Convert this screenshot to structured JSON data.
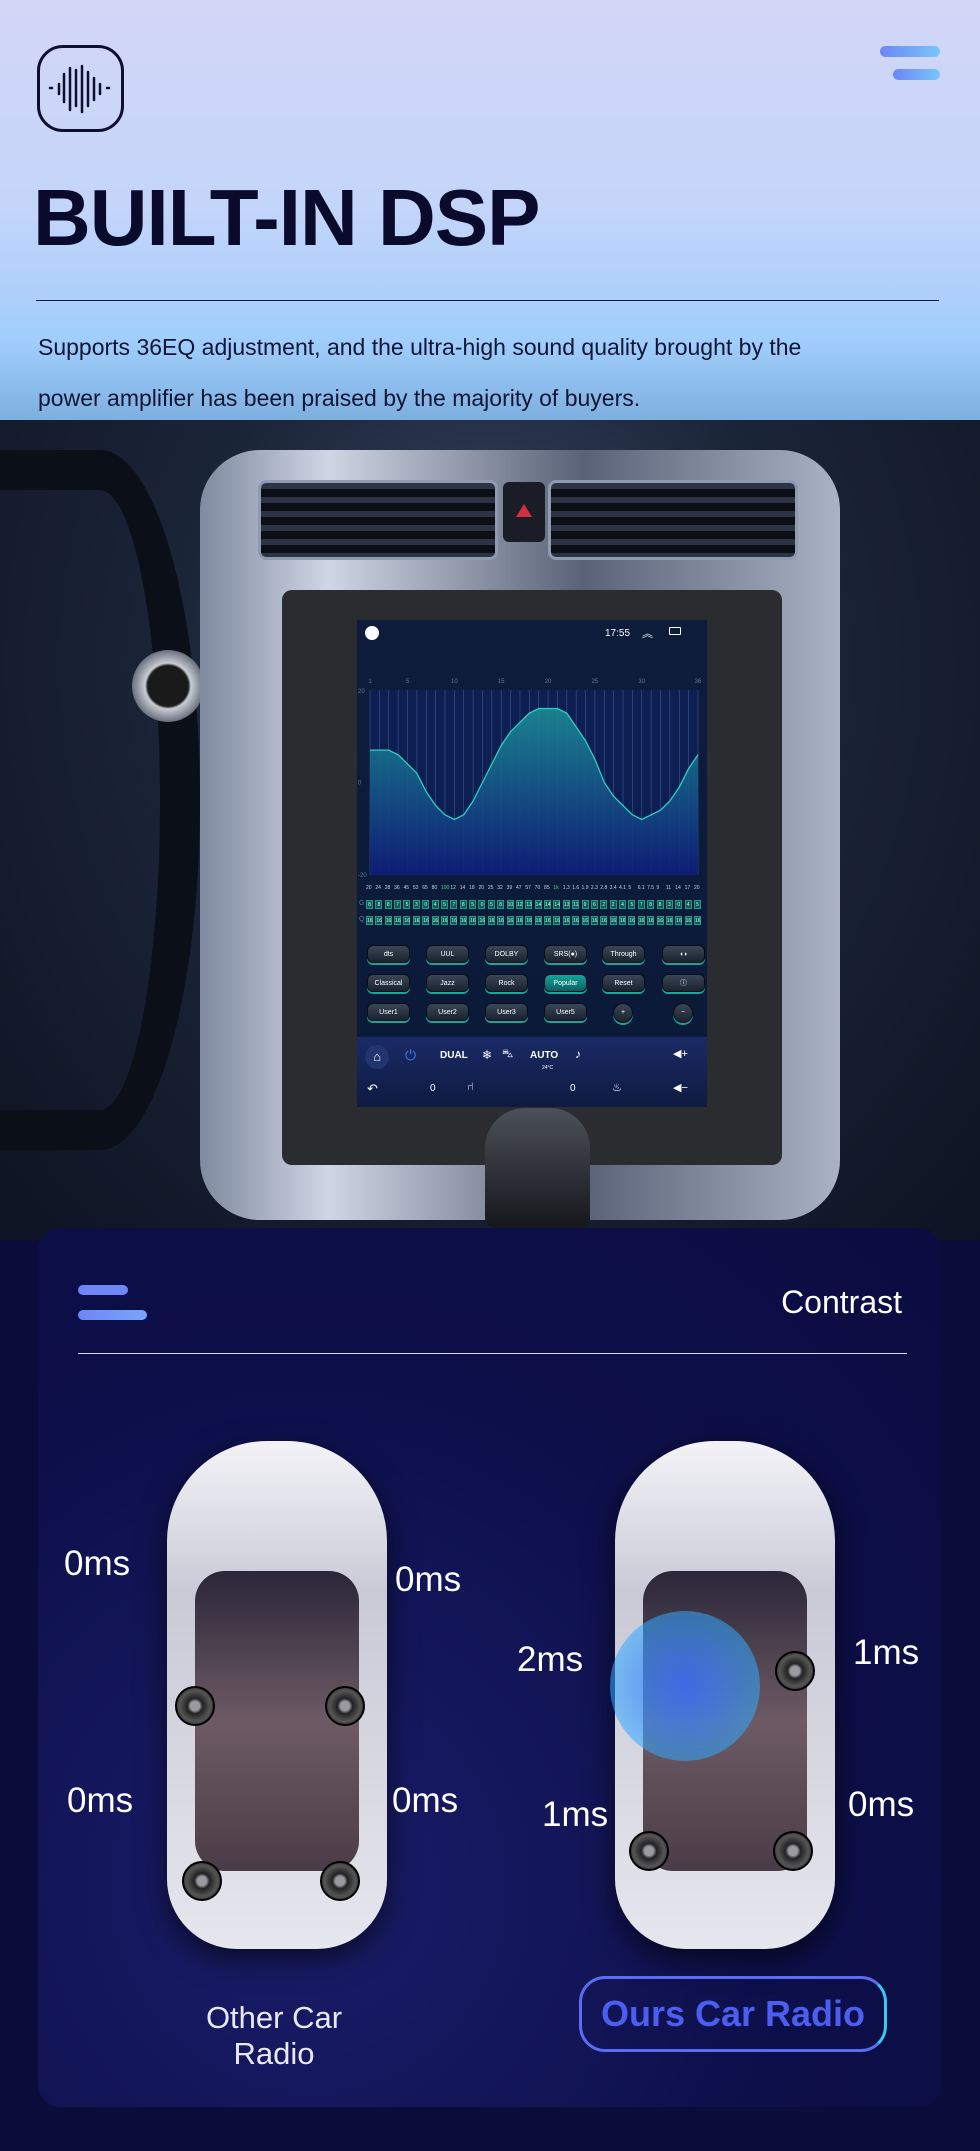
{
  "header": {
    "logo_icon": "sound-wave-icon",
    "menu_icon": "menu-icon",
    "title": "BUILT-IN DSP",
    "description_lines": [
      "Supports 36EQ adjustment, and the ultra-high sound quality brought by the",
      "power amplifier has been praised by the majority of buyers."
    ]
  },
  "head_unit": {
    "status": {
      "time": "17:55",
      "back_icon": "back-circle-icon",
      "collapse_icon": "double-chevron-up-icon",
      "window_icon": "recent-apps-icon"
    },
    "eq": {
      "band_numbers": [
        "1",
        "5",
        "10",
        "15",
        "20",
        "25",
        "30",
        "36"
      ],
      "y_ticks": [
        "20",
        "0",
        "-20"
      ],
      "y_range": [
        -20,
        20
      ],
      "curve_db": [
        7,
        7,
        7,
        6,
        4,
        2,
        -2,
        -5,
        -7,
        -8,
        -7,
        -4,
        0,
        4,
        8,
        11,
        13,
        15,
        16,
        16,
        16,
        15,
        12,
        9,
        5,
        0,
        -3,
        -5,
        -7,
        -8,
        -7,
        -6,
        -4,
        -1,
        3,
        6
      ],
      "frequencies": [
        "20",
        "24",
        "28",
        "36",
        "45",
        "53",
        "65",
        "80",
        "100",
        "12",
        "14",
        "18",
        "20",
        "25",
        "32",
        "39",
        "47",
        "57",
        "70",
        "85",
        "1k",
        "1.3",
        "1.6",
        "1.9",
        "2.3",
        "2.8",
        "3.4",
        "4.1",
        "5",
        "6.1",
        "7.5",
        "9",
        "11",
        "14",
        "17",
        "20"
      ],
      "highlighted_frequencies": [
        "100",
        "1k"
      ],
      "row_labels": [
        "G",
        "Q"
      ],
      "gain": [
        "8",
        "8",
        "8",
        "7",
        "5",
        "3",
        "0",
        "4",
        "5",
        "7",
        "8",
        "5",
        "0",
        "5",
        "8",
        "10",
        "12",
        "13",
        "14",
        "14",
        "14",
        "13",
        "11",
        "9",
        "6",
        "2",
        "2",
        "4",
        "5",
        "7",
        "8",
        "8",
        "3",
        "0",
        "4",
        "5"
      ],
      "q": [
        "16",
        "16",
        "16",
        "16",
        "16",
        "16",
        "16",
        "16",
        "16",
        "16",
        "16",
        "16",
        "16",
        "16",
        "16",
        "16",
        "16",
        "16",
        "16",
        "16",
        "16",
        "16",
        "16",
        "16",
        "16",
        "16",
        "16",
        "16",
        "16",
        "16",
        "16",
        "16",
        "16",
        "16",
        "16",
        "16"
      ]
    },
    "buttons": [
      [
        "dts",
        "UUL",
        "DOLBY",
        "SRS(●)",
        "Through",
        "◖◗"
      ],
      [
        "Classical",
        "Jazz",
        "Rock",
        "Popular",
        "Reset",
        "ⓘ"
      ],
      [
        "User1",
        "User2",
        "User3",
        "User5",
        "+",
        "−"
      ]
    ],
    "active_preset": "Popular",
    "nav": {
      "dual": "DUAL",
      "auto": "AUTO",
      "temp": "24°C",
      "left_value": "0",
      "right_value": "0"
    }
  },
  "contrast": {
    "title": "Contrast",
    "other": {
      "label": "Other Car Radio",
      "delays": [
        "0ms",
        "0ms",
        "0ms",
        "0ms"
      ]
    },
    "ours": {
      "label": "Ours Car Radio",
      "delays": [
        "2ms",
        "1ms",
        "1ms",
        "0ms"
      ]
    }
  },
  "colors": {
    "accent_blue": "#5b6cf0",
    "accent_cyan": "#38c8f0",
    "title": "#090a2c",
    "card_bg": "#0d0f4a",
    "eq_teal": "#2fd0c0"
  }
}
